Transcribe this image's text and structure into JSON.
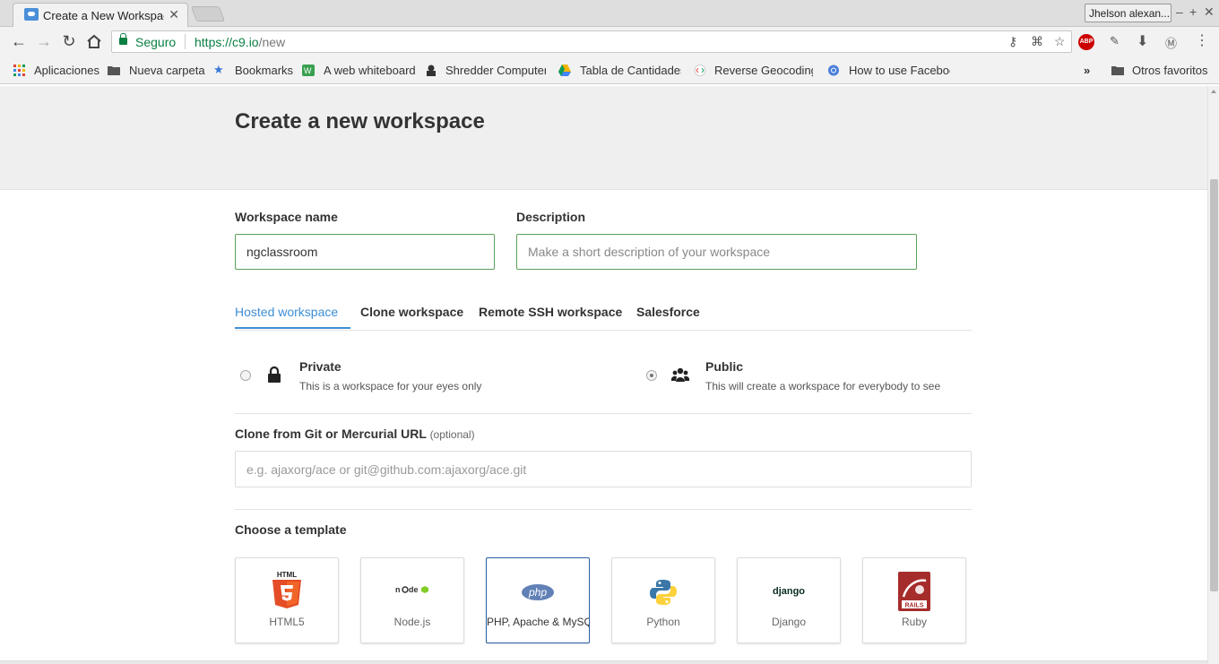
{
  "browser": {
    "tab_title": "Create a New Workspace",
    "profile": "Jhelson alexan...",
    "secure_label": "Seguro",
    "url_host": "https://c9.io",
    "url_path": "/new",
    "bookmarks": [
      "Aplicaciones",
      "Nueva carpeta",
      "Bookmarks",
      "A web whiteboard",
      "Shredder Computer",
      "Tabla de Cantidades",
      "Reverse Geocoding",
      "How to use Facebook"
    ],
    "overflow": "»",
    "other_bookmarks": "Otros favoritos"
  },
  "page": {
    "title": "Create a new workspace",
    "workspace_name_label": "Workspace name",
    "workspace_name_value": "ngclassroom",
    "description_label": "Description",
    "description_placeholder": "Make a short description of your workspace",
    "tabs": [
      "Hosted workspace",
      "Clone workspace",
      "Remote SSH workspace",
      "Salesforce"
    ],
    "private_title": "Private",
    "private_desc": "This is a workspace for your eyes only",
    "public_title": "Public",
    "public_desc": "This will create a workspace for everybody to see",
    "clone_label": "Clone from Git or Mercurial URL",
    "clone_optional": "(optional)",
    "clone_placeholder": "e.g. ajaxorg/ace or git@github.com:ajaxorg/ace.git",
    "template_heading": "Choose a template",
    "templates": [
      "HTML5",
      "Node.js",
      "PHP, Apache & MySQL",
      "Python",
      "Django",
      "Ruby"
    ],
    "html5_logo_text": "HTML",
    "php_logo_text": "php",
    "django_logo_text": "django",
    "rails_logo_text": "RAILS"
  },
  "colors": {
    "accent": "#3d8ed8",
    "secure": "#0b8043",
    "input_border": "#5aa05a",
    "selected_template_border": "#2b5fa8"
  }
}
